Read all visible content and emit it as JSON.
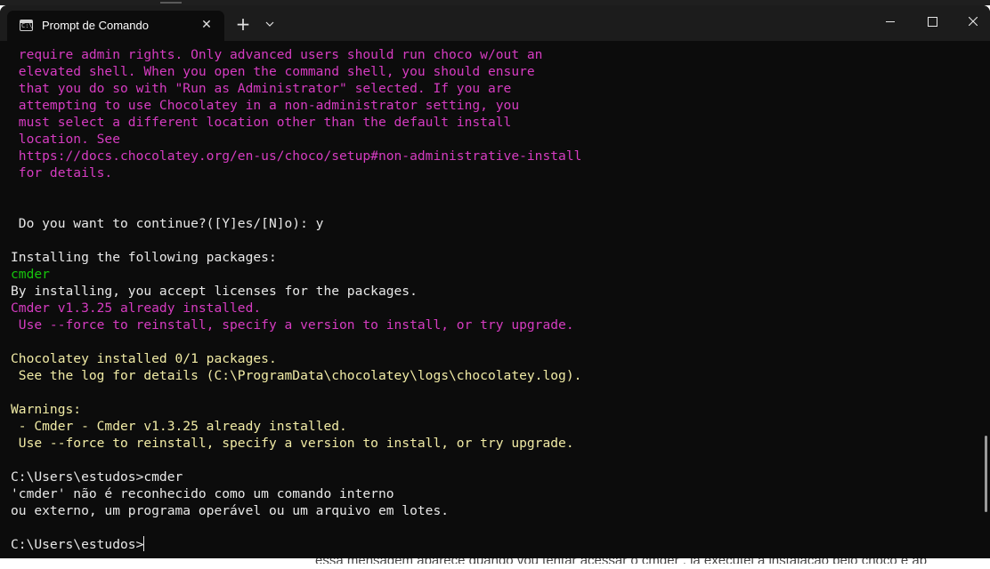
{
  "window": {
    "tab_title": "Prompt de Comando",
    "tab_icon": "cmd-icon",
    "close_tab_glyph": "✕",
    "new_tab_glyph": "+",
    "dropdown_glyph": "⌄"
  },
  "console_lines": [
    {
      "color": "magenta",
      "text": " require admin rights. Only advanced users should run choco w/out an"
    },
    {
      "color": "magenta",
      "text": " elevated shell. When you open the command shell, you should ensure"
    },
    {
      "color": "magenta",
      "text": " that you do so with \"Run as Administrator\" selected. If you are"
    },
    {
      "color": "magenta",
      "text": " attempting to use Chocolatey in a non-administrator setting, you"
    },
    {
      "color": "magenta",
      "text": " must select a different location other than the default install"
    },
    {
      "color": "magenta",
      "text": " location. See"
    },
    {
      "color": "magenta",
      "text": " https://docs.chocolatey.org/en-us/choco/setup#non-administrative-install"
    },
    {
      "color": "magenta",
      "text": " for details."
    },
    {
      "color": "white",
      "text": ""
    },
    {
      "color": "white",
      "text": ""
    },
    {
      "color": "white",
      "text": " Do you want to continue?([Y]es/[N]o): y"
    },
    {
      "color": "white",
      "text": ""
    },
    {
      "color": "white",
      "text": "Installing the following packages:"
    },
    {
      "color": "green",
      "text": "cmder"
    },
    {
      "color": "white",
      "text": "By installing, you accept licenses for the packages."
    },
    {
      "color": "magenta",
      "text": "Cmder v1.3.25 already installed."
    },
    {
      "color": "magenta",
      "text": " Use --force to reinstall, specify a version to install, or try upgrade."
    },
    {
      "color": "white",
      "text": ""
    },
    {
      "color": "yellow",
      "text": "Chocolatey installed 0/1 packages."
    },
    {
      "color": "yellow",
      "text": " See the log for details (C:\\ProgramData\\chocolatey\\logs\\chocolatey.log)."
    },
    {
      "color": "white",
      "text": ""
    },
    {
      "color": "yellow",
      "text": "Warnings:"
    },
    {
      "color": "yellow",
      "text": " - Cmder - Cmder v1.3.25 already installed."
    },
    {
      "color": "yellow",
      "text": " Use --force to reinstall, specify a version to install, or try upgrade."
    },
    {
      "color": "white",
      "text": ""
    },
    {
      "color": "white",
      "text": "C:\\Users\\estudos>cmder"
    },
    {
      "color": "white",
      "text": "'cmder' não é reconhecido como um comando interno"
    },
    {
      "color": "white",
      "text": "ou externo, um programa operável ou um arquivo em lotes."
    },
    {
      "color": "white",
      "text": ""
    }
  ],
  "prompt": {
    "text": "C:\\Users\\estudos>"
  },
  "background_document": {
    "text": "essa mensagem aparece quando vou tentar acessar o cmder , já executei a instalação pelo choco e ab"
  },
  "colors": {
    "terminal_bg": "#0c0c0c",
    "titlebar_bg": "#1c1c1c",
    "magenta": "#d63cc1",
    "yellow": "#f1eba5",
    "white": "#e8e8e8",
    "green": "#16c60c"
  }
}
